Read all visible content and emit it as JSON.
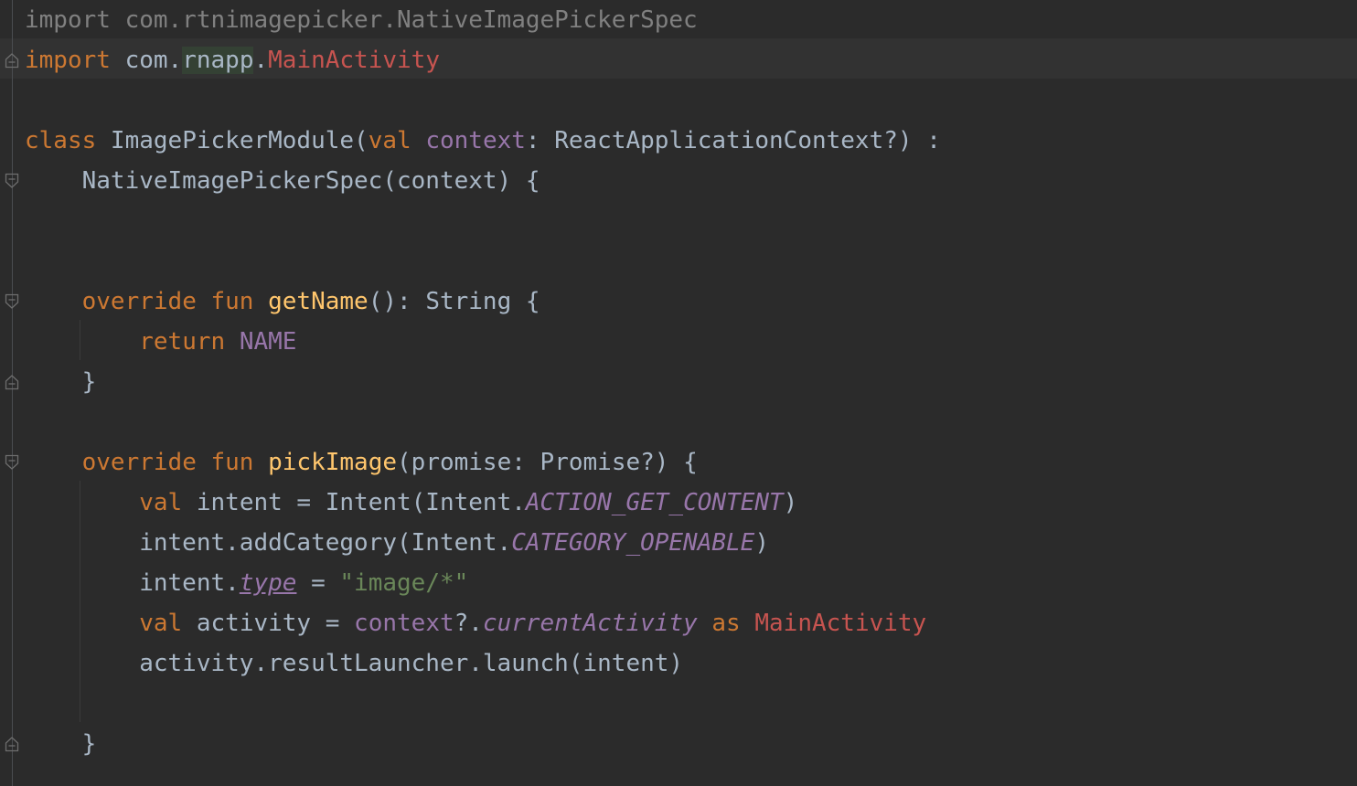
{
  "editor": {
    "lines": [
      {
        "tokens": [
          {
            "t": "import com.rtnimagepicker.NativeImagePickerSpec",
            "c": "gray"
          }
        ]
      },
      {
        "tokens": [
          {
            "t": "import",
            "c": "kw"
          },
          {
            "t": " com.",
            "c": ""
          },
          {
            "t": "rnapp",
            "c": "pkg-hl"
          },
          {
            "t": ".",
            "c": ""
          },
          {
            "t": "MainActivity",
            "c": "cls-red"
          }
        ]
      },
      {
        "tokens": []
      },
      {
        "tokens": [
          {
            "t": "class",
            "c": "kw"
          },
          {
            "t": " ImagePickerModule(",
            "c": ""
          },
          {
            "t": "val",
            "c": "kw"
          },
          {
            "t": " ",
            "c": ""
          },
          {
            "t": "context",
            "c": "param"
          },
          {
            "t": ": ReactApplicationContext?) :",
            "c": ""
          }
        ]
      },
      {
        "tokens": [
          {
            "t": "    NativeImagePickerSpec(context) {",
            "c": ""
          }
        ]
      },
      {
        "tokens": []
      },
      {
        "tokens": []
      },
      {
        "tokens": [
          {
            "t": "    ",
            "c": ""
          },
          {
            "t": "override fun",
            "c": "kw"
          },
          {
            "t": " ",
            "c": ""
          },
          {
            "t": "getName",
            "c": "fn"
          },
          {
            "t": "(): String {",
            "c": ""
          }
        ]
      },
      {
        "tokens": [
          {
            "t": "        ",
            "c": ""
          },
          {
            "t": "return",
            "c": "kw"
          },
          {
            "t": " ",
            "c": ""
          },
          {
            "t": "NAME",
            "c": "const"
          }
        ]
      },
      {
        "tokens": [
          {
            "t": "    }",
            "c": ""
          }
        ]
      },
      {
        "tokens": []
      },
      {
        "tokens": [
          {
            "t": "    ",
            "c": ""
          },
          {
            "t": "override fun",
            "c": "kw"
          },
          {
            "t": " ",
            "c": ""
          },
          {
            "t": "pickImage",
            "c": "fn"
          },
          {
            "t": "(promise: Promise?) {",
            "c": ""
          }
        ]
      },
      {
        "tokens": [
          {
            "t": "        ",
            "c": ""
          },
          {
            "t": "val",
            "c": "kw"
          },
          {
            "t": " intent = Intent(Intent.",
            "c": ""
          },
          {
            "t": "ACTION_GET_CONTENT",
            "c": "prop"
          },
          {
            "t": ")",
            "c": ""
          }
        ]
      },
      {
        "tokens": [
          {
            "t": "        intent.addCategory(Intent.",
            "c": ""
          },
          {
            "t": "CATEGORY_OPENABLE",
            "c": "prop"
          },
          {
            "t": ")",
            "c": ""
          }
        ]
      },
      {
        "tokens": [
          {
            "t": "        intent.",
            "c": ""
          },
          {
            "t": "type",
            "c": "prop und"
          },
          {
            "t": " = ",
            "c": ""
          },
          {
            "t": "\"image/*\"",
            "c": "str"
          }
        ]
      },
      {
        "tokens": [
          {
            "t": "        ",
            "c": ""
          },
          {
            "t": "val",
            "c": "kw"
          },
          {
            "t": " activity = ",
            "c": ""
          },
          {
            "t": "context",
            "c": "param"
          },
          {
            "t": "?.",
            "c": ""
          },
          {
            "t": "currentActivity",
            "c": "prop"
          },
          {
            "t": " ",
            "c": ""
          },
          {
            "t": "as",
            "c": "kw"
          },
          {
            "t": " ",
            "c": ""
          },
          {
            "t": "MainActivity",
            "c": "cls-red"
          }
        ]
      },
      {
        "tokens": [
          {
            "t": "        activity.resultLauncher.launch(intent)",
            "c": ""
          }
        ]
      },
      {
        "tokens": []
      },
      {
        "tokens": [
          {
            "t": "    }",
            "c": ""
          }
        ]
      }
    ],
    "fold_markers": [
      {
        "line": 1,
        "kind": "end"
      },
      {
        "line": 4,
        "kind": "start"
      },
      {
        "line": 7,
        "kind": "start"
      },
      {
        "line": 9,
        "kind": "end"
      },
      {
        "line": 11,
        "kind": "start"
      },
      {
        "line": 18,
        "kind": "end"
      }
    ]
  }
}
